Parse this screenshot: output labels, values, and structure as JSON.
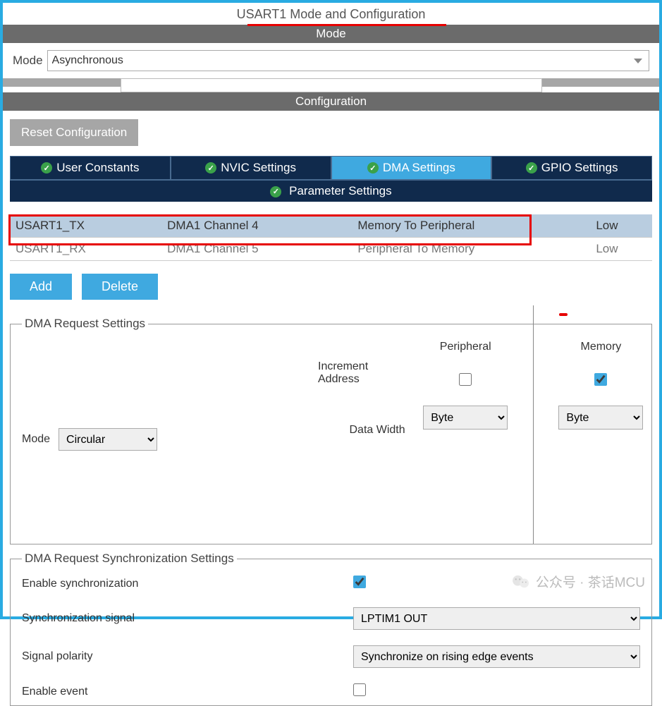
{
  "title": "USART1 Mode and Configuration",
  "sections": {
    "mode": "Mode",
    "configuration": "Configuration"
  },
  "mode_row": {
    "label": "Mode",
    "value": "Asynchronous"
  },
  "reset_btn": "Reset Configuration",
  "tabs": [
    {
      "label": "User Constants",
      "active": false
    },
    {
      "label": "NVIC Settings",
      "active": false
    },
    {
      "label": "DMA Settings",
      "active": true
    },
    {
      "label": "GPIO Settings",
      "active": false
    }
  ],
  "param_tab": "Parameter Settings",
  "dma_table": {
    "rows": [
      {
        "request": "USART1_TX",
        "channel": "DMA1 Channel 4",
        "direction": "Memory To Peripheral",
        "priority": "Low",
        "selected": true
      },
      {
        "request": "USART1_RX",
        "channel": "DMA1 Channel 5",
        "direction": "Peripheral To Memory",
        "priority": "Low",
        "selected": false
      }
    ]
  },
  "buttons": {
    "add": "Add",
    "delete": "Delete"
  },
  "dma_request": {
    "legend": "DMA Request Settings",
    "mode_label": "Mode",
    "mode_value": "Circular",
    "increment_label": "Increment Address",
    "peripheral_label": "Peripheral",
    "memory_label": "Memory",
    "peripheral_inc": false,
    "memory_inc": true,
    "data_width_label": "Data Width",
    "peripheral_width": "Byte",
    "memory_width": "Byte"
  },
  "sync": {
    "legend": "DMA Request Synchronization Settings",
    "enable_sync_label": "Enable synchronization",
    "enable_sync": true,
    "signal_label": "Synchronization signal",
    "signal_value": "LPTIM1 OUT",
    "polarity_label": "Signal polarity",
    "polarity_value": "Synchronize on rising edge events",
    "enable_event_label": "Enable event",
    "enable_event": false
  },
  "watermark": "公众号 · 茶话MCU"
}
